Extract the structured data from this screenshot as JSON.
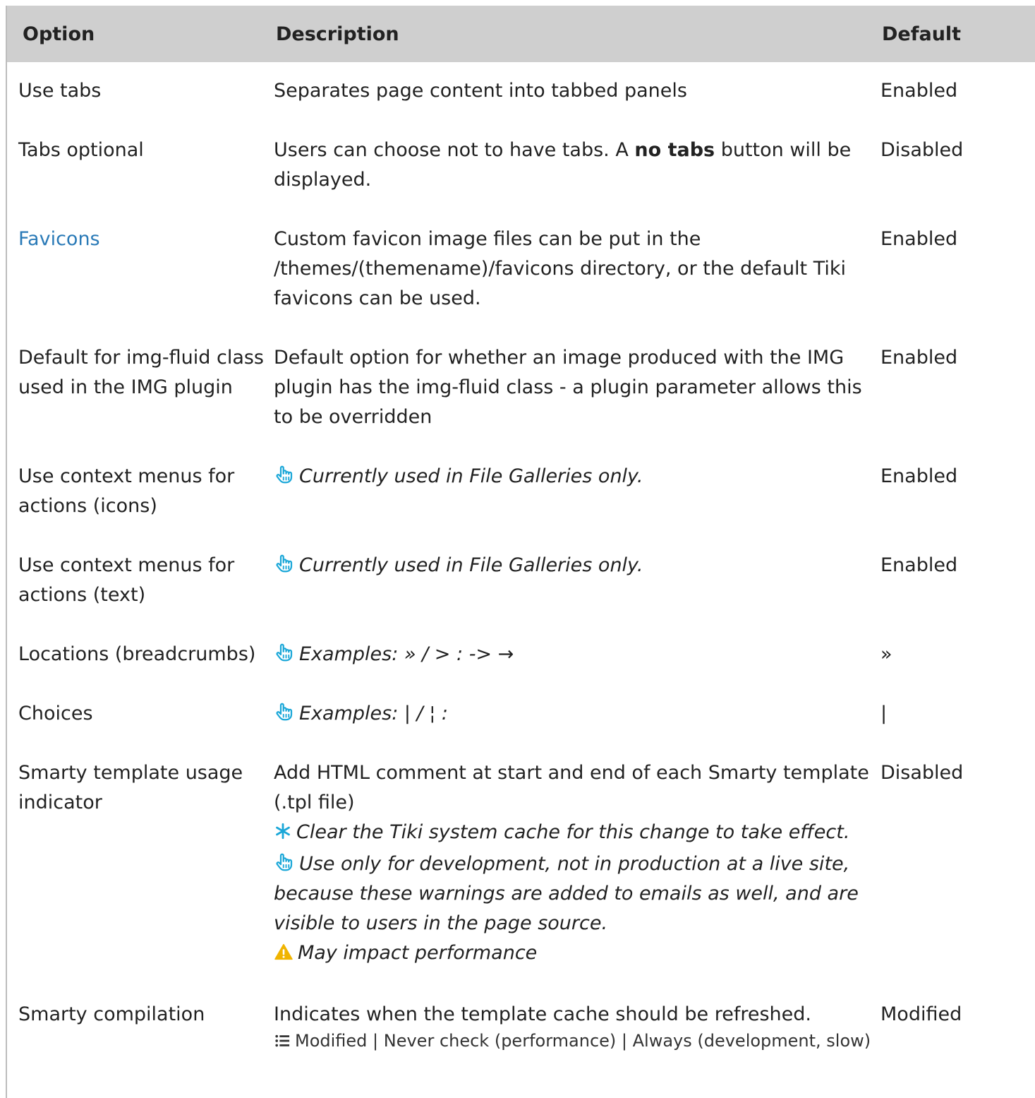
{
  "header": {
    "option": "Option",
    "description": "Description",
    "default": "Default"
  },
  "rows": [
    {
      "option": "Use tabs",
      "description": "Separates page content into tabbed panels",
      "default": "Enabled"
    },
    {
      "option": "Tabs optional",
      "desc_pre": "Users can choose not to have tabs. A ",
      "desc_bold": "no tabs",
      "desc_post": " button will be displayed.",
      "default": "Disabled"
    },
    {
      "option": "Favicons",
      "description": "Custom favicon image files can be put in the /themes/(themename)/favicons directory, or the default Tiki favicons can be used.",
      "default": "Enabled"
    },
    {
      "option": "Default for img-fluid class used in the IMG plugin",
      "description": "Default option for whether an image produced with the IMG plugin has the img-fluid class - a plugin parameter allows this to be overridden",
      "default": "Enabled"
    },
    {
      "option": "Use context menus for actions (icons)",
      "note": "Currently used in File Galleries only.",
      "default": "Enabled"
    },
    {
      "option": "Use context menus for actions (text)",
      "note": "Currently used in File Galleries only.",
      "default": "Enabled"
    },
    {
      "option": "Locations (breadcrumbs)",
      "note": "Examples: » / > : -> →",
      "default": "»"
    },
    {
      "option": "Choices",
      "note": "Examples: | / ¦ :",
      "default": "|"
    },
    {
      "option": "Smarty template usage indicator",
      "description": "Add HTML comment at start and end of each Smarty template (.tpl file)",
      "note_cache": "Clear the Tiki system cache for this change to take effect.",
      "note_dev": "Use only for development, not in production at a live site, because these warnings are added to emails as well, and are visible to users in the page source.",
      "note_perf": "May impact performance",
      "default": "Disabled"
    },
    {
      "option": "Smarty compilation",
      "description": "Indicates when the template cache should be refreshed.",
      "choices": "Modified | Never check (performance) | Always (development, slow)",
      "default": "Modified"
    }
  ],
  "colors": {
    "header_bg": "#cfcfcf",
    "link": "#2a7ab7",
    "tip_icon": "#1aa7d8",
    "warning_icon": "#f0b400"
  }
}
